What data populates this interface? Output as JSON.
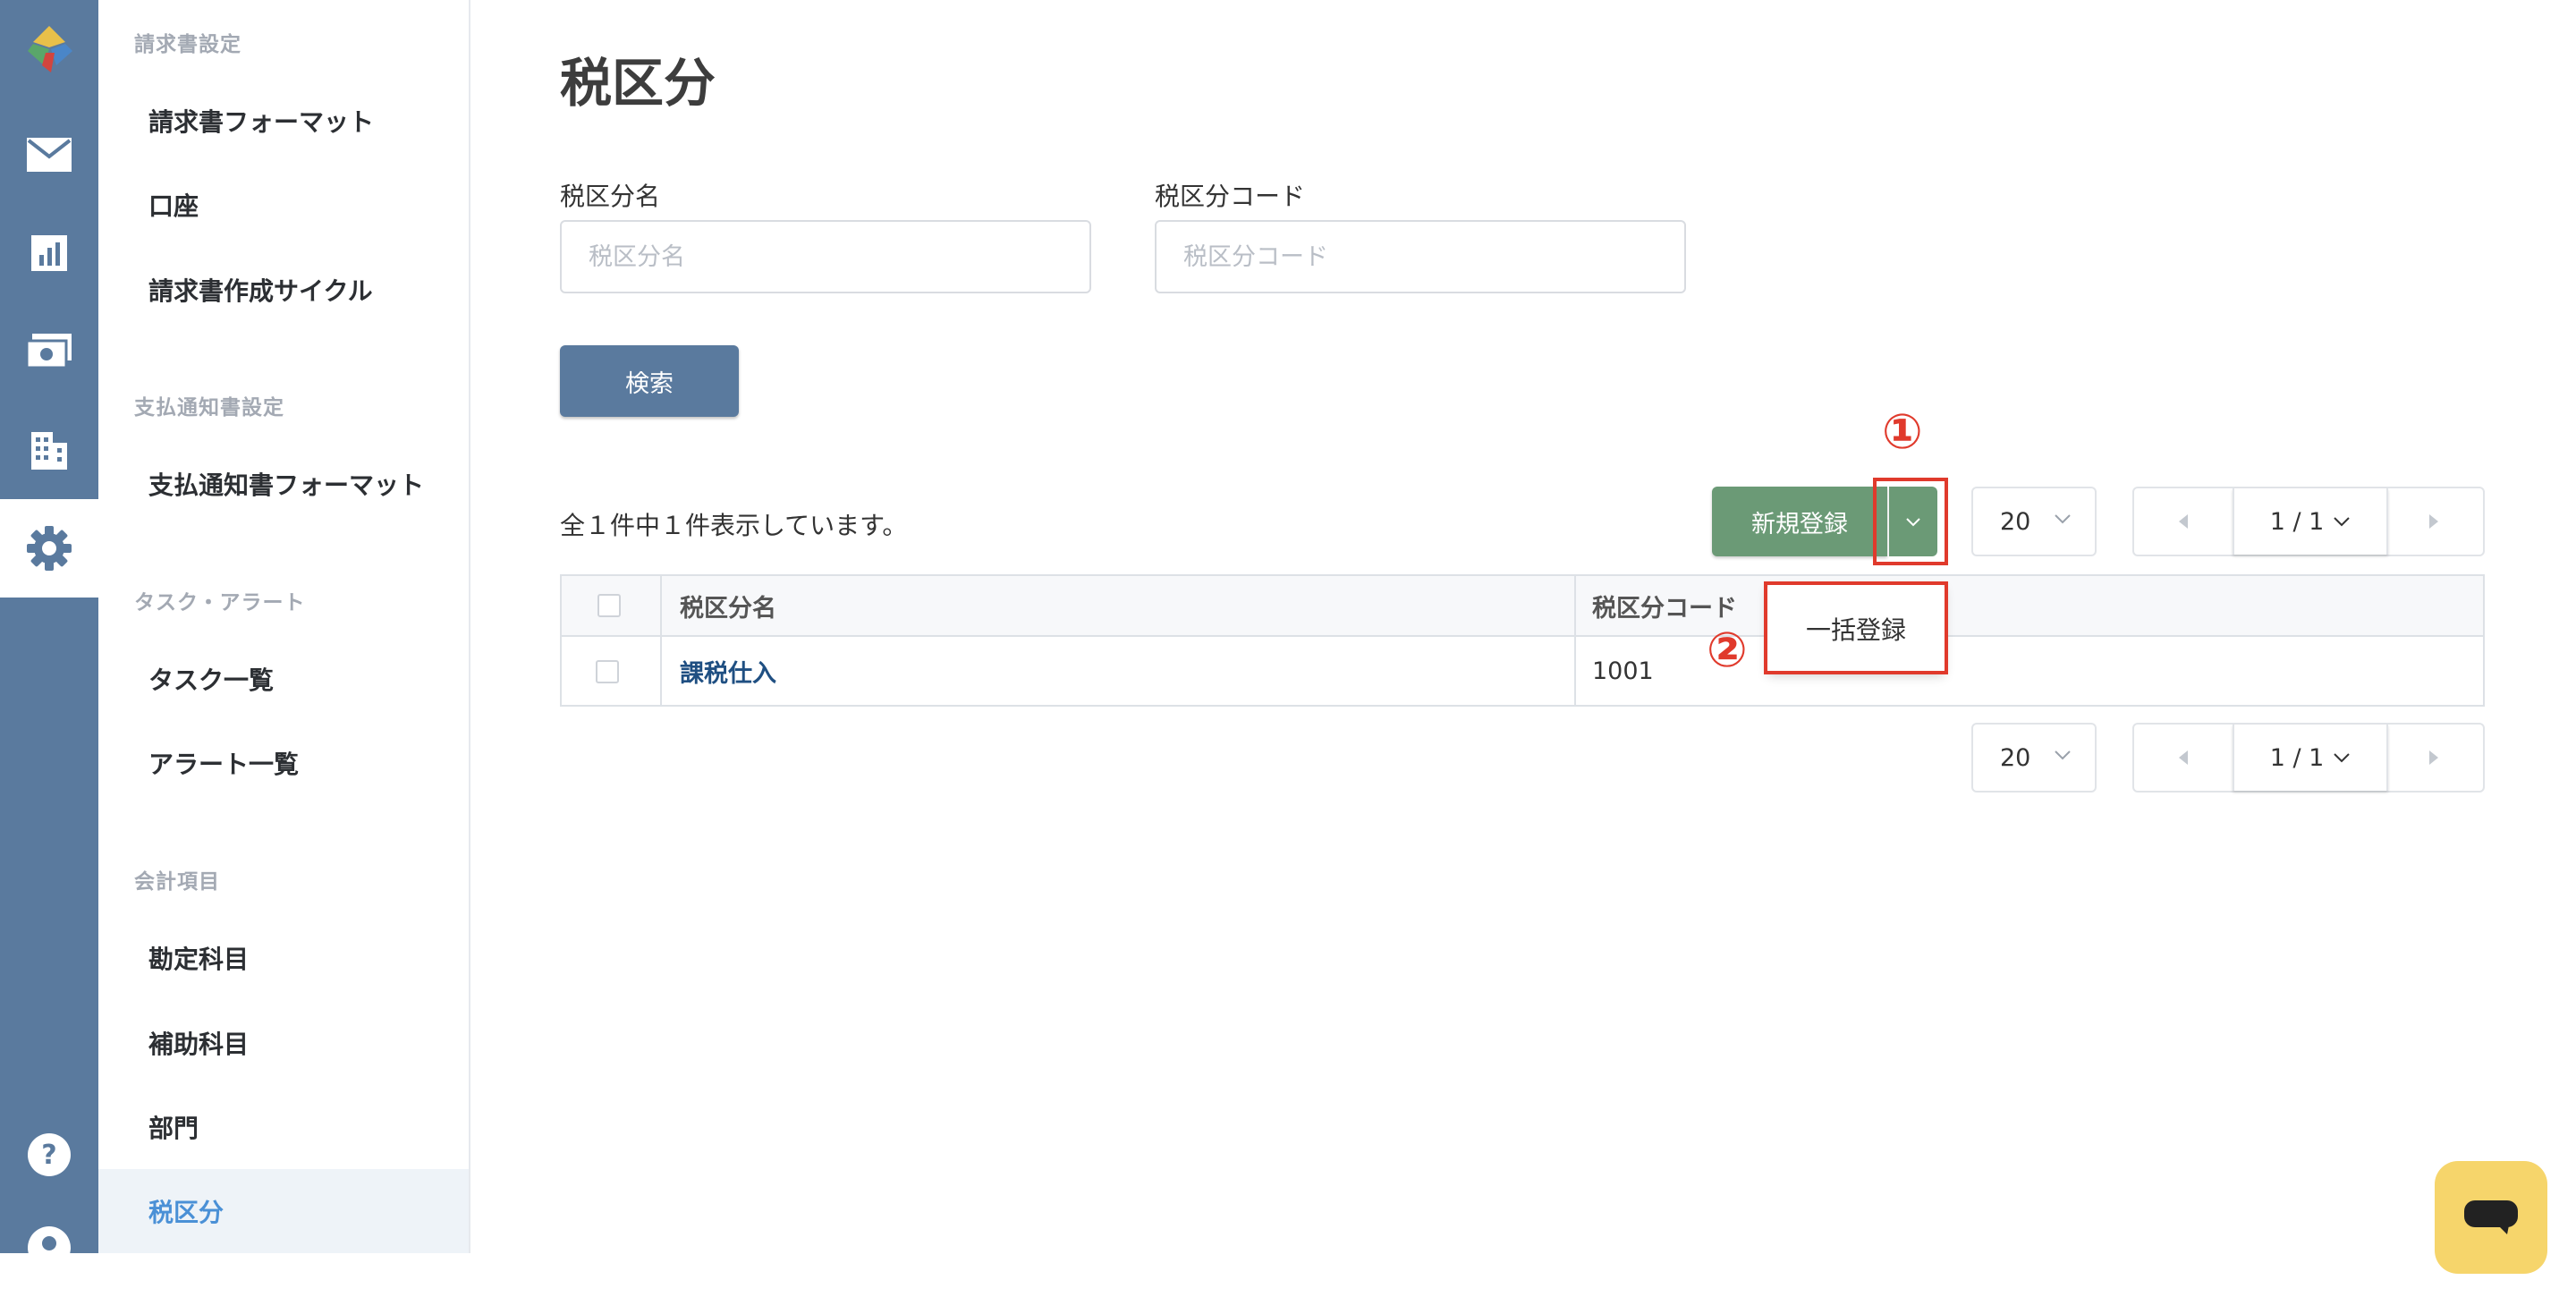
{
  "rail": {
    "icons": [
      "logo-icon",
      "mail-icon",
      "chart-icon",
      "payment-icon",
      "building-icon",
      "gear-icon",
      "help-icon",
      "user-icon"
    ],
    "active": "gear-icon",
    "color": "#5a7a9e"
  },
  "menu": {
    "sections": [
      {
        "title": "請求書設定",
        "items": [
          "請求書フォーマット",
          "口座",
          "請求書作成サイクル"
        ]
      },
      {
        "title": "支払通知書設定",
        "items": [
          "支払通知書フォーマット"
        ]
      },
      {
        "title": "タスク・アラート",
        "items": [
          "タスク一覧",
          "アラート一覧"
        ]
      },
      {
        "title": "会計項目",
        "items": [
          "勘定科目",
          "補助科目",
          "部門",
          "税区分"
        ]
      }
    ],
    "active_item": "税区分"
  },
  "page": {
    "title": "税区分"
  },
  "search": {
    "name_label": "税区分名",
    "name_placeholder": "税区分名",
    "code_label": "税区分コード",
    "code_placeholder": "税区分コード",
    "button": "検索"
  },
  "toolbar": {
    "count_text": "全１件中１件表示しています。",
    "new_button": "新規登録",
    "dropdown_item": "一括登録",
    "per_page": "20",
    "page_indicator": "1 / 1"
  },
  "annotations": {
    "first": "①",
    "second": "②",
    "color": "#e03a2c"
  },
  "table": {
    "headers": [
      "税区分名",
      "税区分コード"
    ],
    "rows": [
      {
        "name": "課税仕入",
        "code": "1001"
      }
    ]
  },
  "colors": {
    "primary": "#5a7a9e",
    "success": "#6b9a76",
    "chat": "#f6d56b",
    "link": "#1f4f82"
  }
}
